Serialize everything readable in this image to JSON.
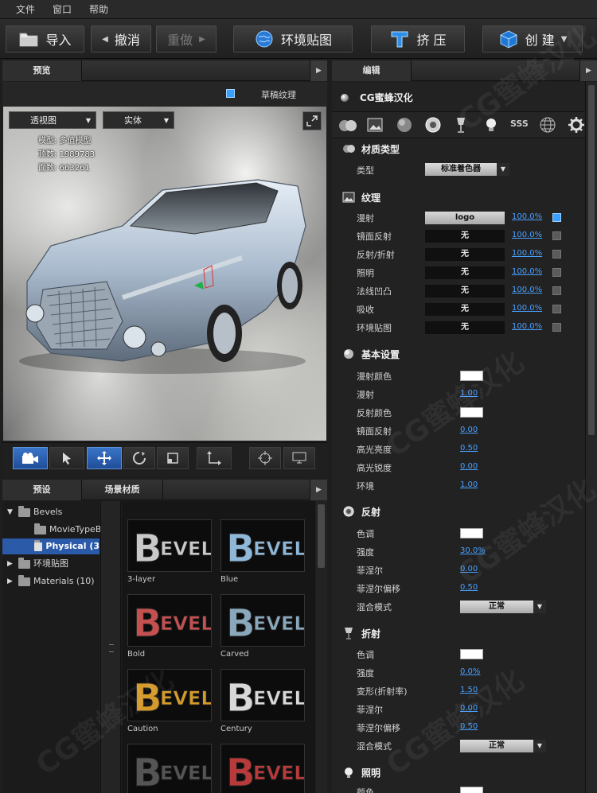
{
  "menu": [
    "文件",
    "窗口",
    "帮助"
  ],
  "toolbar": {
    "import": "导入",
    "undo": "撤消",
    "redo": "重做",
    "env_map": "环境贴图",
    "extrude": "挤 压",
    "create": "创 建"
  },
  "preview": {
    "tab": "预览",
    "draft_texture": "草稿纹理",
    "view_mode": "透视图",
    "shade_mode": "实体",
    "stats": {
      "model_label": "模型:",
      "model_value": "多值模型",
      "vertices_label": "顶数:",
      "vertices_value": "1989783",
      "faces_label": "面数:",
      "faces_value": "663261"
    }
  },
  "presets": {
    "tab_presets": "预设",
    "tab_scene": "场景材质",
    "tree": [
      {
        "label": "Bevels",
        "level": 0,
        "expanded": true
      },
      {
        "label": "MovieTypeB",
        "level": 1
      },
      {
        "label": "Physical (3",
        "level": 1,
        "selected": true
      },
      {
        "label": "环境贴图",
        "level": 0,
        "expanded": false
      },
      {
        "label": "Materials (10)",
        "level": 0,
        "expanded": false
      }
    ],
    "thumbs": [
      "3-layer",
      "Blue",
      "Bold",
      "Carved",
      "Caution",
      "Century",
      "",
      ""
    ],
    "thumb_colors": [
      "#c9c9c9",
      "#8fb8d8",
      "#c45050",
      "#8aa8bc",
      "#d49a2a",
      "#d8d8d8",
      "#555555",
      "#b83a3a"
    ]
  },
  "editor": {
    "tab": "编辑",
    "title": "CG蜜蜂汉化",
    "material_type": {
      "header": "材质类型",
      "type_label": "类型",
      "type_value": "标准着色器"
    },
    "texture": {
      "header": "纹理",
      "rows": [
        {
          "label": "漫射",
          "value": "logo",
          "pct": "100.0%",
          "on": true
        },
        {
          "label": "镜面反射",
          "value": "无",
          "pct": "100.0%",
          "on": false
        },
        {
          "label": "反射/折射",
          "value": "无",
          "pct": "100.0%",
          "on": false
        },
        {
          "label": "照明",
          "value": "无",
          "pct": "100.0%",
          "on": false
        },
        {
          "label": "法线凹凸",
          "value": "无",
          "pct": "100.0%",
          "on": false
        },
        {
          "label": "吸收",
          "value": "无",
          "pct": "100.0%",
          "on": false
        },
        {
          "label": "环境贴图",
          "value": "无",
          "pct": "100.0%",
          "on": false
        }
      ]
    },
    "basic": {
      "header": "基本设置",
      "rows": [
        {
          "label": "漫射颜色",
          "swatch": "#ffffff"
        },
        {
          "label": "漫射",
          "value": "1.00"
        },
        {
          "label": "反射颜色",
          "swatch": "#ffffff"
        },
        {
          "label": "镜面反射",
          "value": "0.00"
        },
        {
          "label": "高光亮度",
          "value": "0.50"
        },
        {
          "label": "高光锐度",
          "value": "0.00"
        },
        {
          "label": "环境",
          "value": "1.00"
        }
      ]
    },
    "reflection": {
      "header": "反射",
      "rows": [
        {
          "label": "色调",
          "swatch": "#ffffff"
        },
        {
          "label": "强度",
          "value": "30.0%"
        },
        {
          "label": "菲涅尔",
          "value": "0.00"
        },
        {
          "label": "菲涅尔偏移",
          "value": "0.50"
        },
        {
          "label": "混合模式",
          "dropdown": "正常"
        }
      ]
    },
    "refraction": {
      "header": "折射",
      "rows": [
        {
          "label": "色调",
          "swatch": "#ffffff"
        },
        {
          "label": "强度",
          "value": "0.0%"
        },
        {
          "label": "变形(折射率)",
          "value": "1.50"
        },
        {
          "label": "菲涅尔",
          "value": "0.00"
        },
        {
          "label": "菲涅尔偏移",
          "value": "0.50"
        },
        {
          "label": "混合模式",
          "dropdown": "正常"
        }
      ]
    },
    "lighting": {
      "header": "照明",
      "rows": [
        {
          "label": "颜色",
          "swatch": "#ffffff"
        }
      ]
    }
  },
  "watermark": "CG蜜蜂汉化"
}
